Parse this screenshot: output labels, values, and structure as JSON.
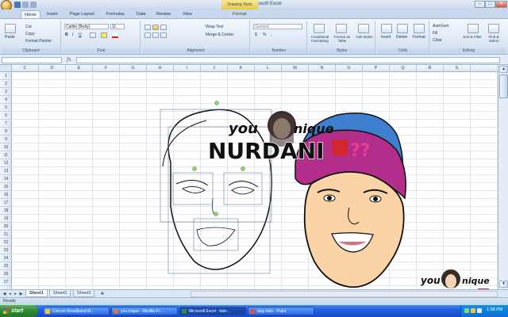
{
  "window": {
    "title": "fatin.xlsx - Microsoft Excel",
    "context_tab_group": "Drawing Tools",
    "controls": {
      "minimize": "–",
      "maximize": "□",
      "close": "✕"
    }
  },
  "tabs": [
    {
      "label": "Home",
      "active": true
    },
    {
      "label": "Insert"
    },
    {
      "label": "Page Layout"
    },
    {
      "label": "Formulas"
    },
    {
      "label": "Data"
    },
    {
      "label": "Review"
    },
    {
      "label": "View"
    },
    {
      "label": "Format"
    }
  ],
  "ribbon": {
    "clipboard": {
      "label": "Clipboard",
      "paste": "Paste",
      "cut": "Cut",
      "copy": "Copy",
      "format_painter": "Format Painter"
    },
    "font": {
      "label": "Font",
      "font_name": "Calibri (Body)",
      "font_size": "11",
      "bold": "B",
      "italic": "I",
      "underline": "U"
    },
    "alignment": {
      "label": "Alignment",
      "wrap_text": "Wrap Text",
      "merge_center": "Merge & Center"
    },
    "number": {
      "label": "Number",
      "format": "General",
      "currency": "$",
      "percent": "%",
      "comma": ","
    },
    "styles": {
      "label": "Styles",
      "conditional": "Conditional Formatting",
      "format_table": "Format as Table",
      "cell_styles": "Cell Styles"
    },
    "cells": {
      "label": "Cells",
      "insert": "Insert",
      "delete": "Delete",
      "format": "Format"
    },
    "editing": {
      "label": "Editing",
      "autosum": "AutoSum",
      "fill": "Fill",
      "clear": "Clear",
      "sort_filter": "Sort & Filter",
      "find_select": "Find & Select"
    }
  },
  "formula_bar": {
    "name_box": "",
    "fx": "fx",
    "formula": ""
  },
  "columns": [
    "C",
    "D",
    "E",
    "F",
    "G",
    "H",
    "I",
    "J",
    "K",
    "L",
    "M",
    "N",
    "O",
    "P",
    "Q",
    "R",
    "S"
  ],
  "rows": [
    "1",
    "2",
    "3",
    "4",
    "5",
    "6",
    "7",
    "8",
    "9",
    "10",
    "11",
    "12",
    "13",
    "14",
    "15",
    "16",
    "17",
    "18",
    "19",
    "20",
    "21",
    "22",
    "23",
    "24",
    "25",
    "26",
    "27"
  ],
  "watermark": {
    "top": "you",
    "unique": "nique",
    "name": "NURDANI"
  },
  "sheets": [
    {
      "label": "Sheet1",
      "active": true
    },
    {
      "label": "Sheet2"
    },
    {
      "label": "Sheet3"
    }
  ],
  "status": {
    "ready": "Ready"
  },
  "taskbar": {
    "start": "start",
    "items": [
      {
        "label": "Celcom Broadband M..."
      },
      {
        "label": "you.tnique - Mozilla Fi..."
      },
      {
        "label": "Microsoft Excel - fatin...",
        "active": true
      },
      {
        "label": "step fatin - Paint"
      }
    ],
    "clock": "1:58 PM"
  },
  "colors": {
    "accent": "#1f5fe0",
    "hijab_magenta": "#b32e8a",
    "hijab_blue": "#3f7fd0",
    "skin": "#fad3a6"
  }
}
